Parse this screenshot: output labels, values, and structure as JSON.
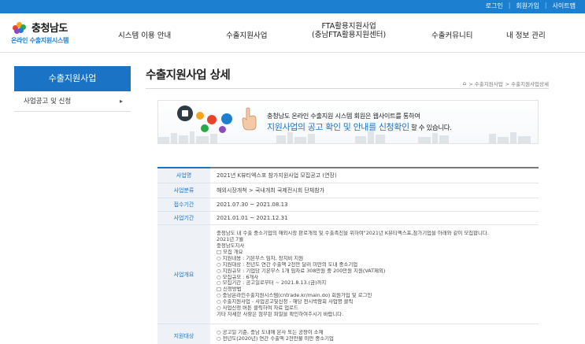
{
  "topbar": {
    "links": [
      "로그인",
      "회원가입",
      "사이트맵"
    ],
    "separator": "|"
  },
  "logo": {
    "name": "충청남도",
    "subtitle": "온라인 수출지원시스템"
  },
  "nav": {
    "items": [
      {
        "label": "시스템 이용 안내"
      },
      {
        "label": "수출지원사업"
      },
      {
        "label": "FTA활용지원사업",
        "sub": "(충남FTA활용지원센터)"
      },
      {
        "label": "수출커뮤니티"
      },
      {
        "label": "내 정보 관리"
      }
    ]
  },
  "sidebar": {
    "title": "수출지원사업",
    "items": [
      {
        "label": "사업공고 및 신청",
        "arrow": "▸"
      }
    ]
  },
  "main": {
    "title": "수출지원사업 상세",
    "breadcrumb": {
      "home_icon": "⌂",
      "items": [
        "> 수출지원사업",
        "> 수출지원사업상세"
      ]
    }
  },
  "banner": {
    "line1": "충청남도 온라인 수출지원 시스템 회원은 웹사이트를 통하여",
    "line2_highlight": "지원사업의 공고 확인 및 안내를 신청확인",
    "line2_tail": " 할 수 있습니다."
  },
  "details": {
    "rows": [
      {
        "label": "사업명",
        "value": "2021년 K뷰티엑스포 참가지원사업 모집공고 (연장)"
      },
      {
        "label": "사업분류",
        "value": "해외시장개척 > 국내개최 국제전시회 단체참가"
      },
      {
        "label": "접수기간",
        "value": "2021.07.30 ~ 2021.08.13"
      },
      {
        "label": "사업기간",
        "value": "2021.01.01 ~ 2021.12.31"
      },
      {
        "label": "사업개요",
        "lines": [
          "충청남도 내 수출 중소기업의 해외시장 판로개척 및 수출촉진을 위하여\"2021년 K뷰티엑스포,참가기업을 아래와 같이 모집합니다.",
          "2021년 7월",
          "충청남도지사",
          "□ 모집 개요",
          "○ 지원내용 : 기본부스 임차, 장치비 지원",
          "○ 지원대상 : 전년도 연간 수출액 2천만 달러 미만의 도내 중소기업",
          "○ 지원규모 : 기업당 기본부스 1개 임차료 308만원 중 200만원 지원(VAT제외)",
          "○ 모집규모 : 6개사",
          "○ 모집기간 : 공고일로부터 ~ 2021.8.13.(금)까지",
          "□ 신청방법",
          "○ 충남온라인수출지원시스템(cntrade.kr/main.do) 회원가입 및 로그인",
          "○ 수출지원사업 - 사업공고및신청 - 해당 전시박람회 사업명 클릭",
          "○ 사업신청 버튼 클릭하여 자료 업로드",
          "기타 자세한 사항은 첨부된 파일을 확인하여주시기 바랍니다."
        ]
      },
      {
        "label": "지원대상",
        "lines": [
          "○ 공고일 기준, 충남 도내에 본사 또는 공장이 소재",
          "○ 전년도(2020년) 연간 수출액 2천만불 미만 중소기업"
        ]
      }
    ]
  },
  "colors": {
    "topbar": "#1d7fd0",
    "accent": "#1b73c5",
    "label_bg": "#eef2f7"
  }
}
